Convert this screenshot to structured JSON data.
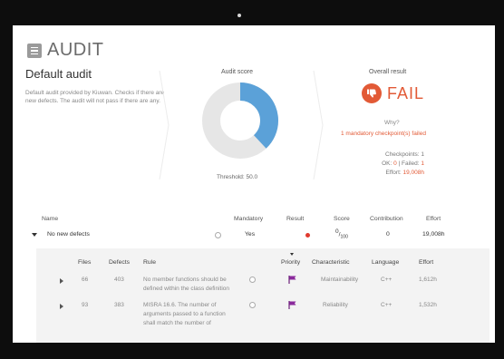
{
  "app": {
    "title": "AUDIT"
  },
  "audit": {
    "name": "Default audit",
    "description": "Default audit provided by Kiuwan. Checks if there are new defects. The audit will not pass if there are any."
  },
  "score": {
    "label": "Audit score",
    "threshold": "Threshold: 50.0",
    "fraction_shown": 0.38,
    "colors": {
      "filled": "#5ba1d8",
      "empty": "#e6e6e6"
    }
  },
  "result": {
    "label": "Overall result",
    "status": "FAIL",
    "why": "Why?",
    "reason": "1 mandatory checkpoint(s) failed",
    "checkpoints": "Checkpoints: 1",
    "ok_label": "OK:",
    "ok_value": "0",
    "failed_label": "Failed:",
    "failed_value": "1",
    "effort_label": "Effort:",
    "effort_value": "19,008h",
    "color": "#e25a36"
  },
  "table": {
    "headers": {
      "name": "Name",
      "mandatory": "Mandatory",
      "result": "Result",
      "score": "Score",
      "contribution": "Contribution",
      "effort": "Effort"
    },
    "rows": [
      {
        "name": "No new defects",
        "mandatory": "Yes",
        "score_num": "0",
        "score_den": "100",
        "contribution": "0",
        "effort": "19,008h"
      }
    ]
  },
  "sub_table": {
    "headers": {
      "files": "Files",
      "defects": "Defects",
      "rule": "Rule",
      "priority": "Priority",
      "characteristic": "Characteristic",
      "language": "Language",
      "effort": "Effort"
    },
    "rows": [
      {
        "files": "66",
        "defects": "403",
        "rule_line1": "No member functions should be",
        "rule_line2": "defined within the class definition",
        "characteristic": "Maintainability",
        "language": "C++",
        "effort": "1,612h"
      },
      {
        "files": "93",
        "defects": "383",
        "rule_line1": "MISRA 16.6. The number of",
        "rule_line2": "arguments passed to a function",
        "rule_line3": "shall match the number of",
        "characteristic": "Reliability",
        "language": "C++",
        "effort": "1,532h"
      }
    ]
  },
  "icons": {
    "menu": "menu-icon",
    "thumb_down": "thumbs-down-icon",
    "info": "info-icon",
    "flag": "priority-flag-icon"
  }
}
